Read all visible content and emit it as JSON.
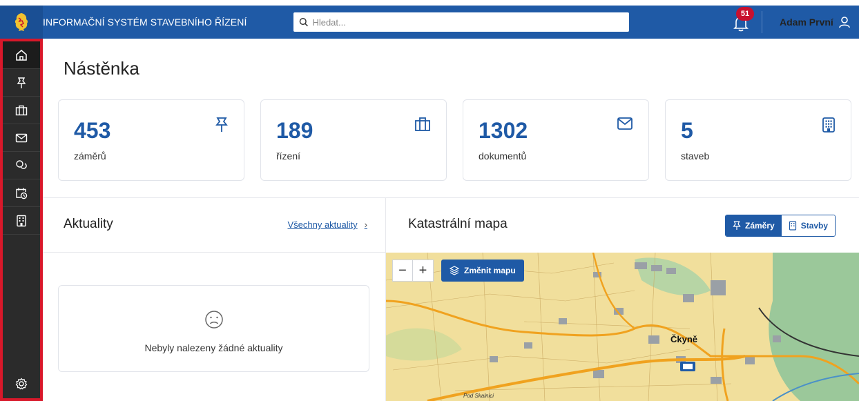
{
  "header": {
    "app_title": "INFORMAČNÍ SYSTÉM STAVEBNÍHO ŘÍZENÍ",
    "search_placeholder": "Hledat...",
    "notification_count": "51",
    "user_name": "Adam První"
  },
  "sidebar": {
    "items": [
      {
        "icon": "home-icon",
        "active": true
      },
      {
        "icon": "pin-icon"
      },
      {
        "icon": "briefcase-icon"
      },
      {
        "icon": "mail-icon"
      },
      {
        "icon": "coins-icon"
      },
      {
        "icon": "calendar-icon"
      },
      {
        "icon": "building-icon"
      }
    ],
    "bottom_icon": "settings-icon"
  },
  "page": {
    "title": "Nástěnka"
  },
  "stats": [
    {
      "value": "453",
      "label": "záměrů",
      "icon": "pin-icon"
    },
    {
      "value": "189",
      "label": "řízení",
      "icon": "briefcase-icon"
    },
    {
      "value": "1302",
      "label": "dokumentů",
      "icon": "mail-icon"
    },
    {
      "value": "5",
      "label": "staveb",
      "icon": "building-icon"
    }
  ],
  "news": {
    "title": "Aktuality",
    "all_link": "Všechny aktuality",
    "empty_message": "Nebyly nalezeny žádné aktuality"
  },
  "map": {
    "title": "Katastrální mapa",
    "toggle_zamery": "Záměry",
    "toggle_stavby": "Stavby",
    "zoom_out": "−",
    "zoom_in": "+",
    "change_map": "Změnit mapu",
    "place_label": "Čkyně",
    "street_label": "Pod Skalnici",
    "colors": {
      "background": "#f1df9c",
      "road": "#f0a21f",
      "forest": "#8cc49a",
      "building": "#9aa0a6"
    }
  },
  "colors": {
    "header": "#1f5aa6",
    "sidebar": "#2b2b2b",
    "sidebar_border": "#d8182a",
    "accent": "#1f5aa6",
    "badge": "#c8102e"
  }
}
